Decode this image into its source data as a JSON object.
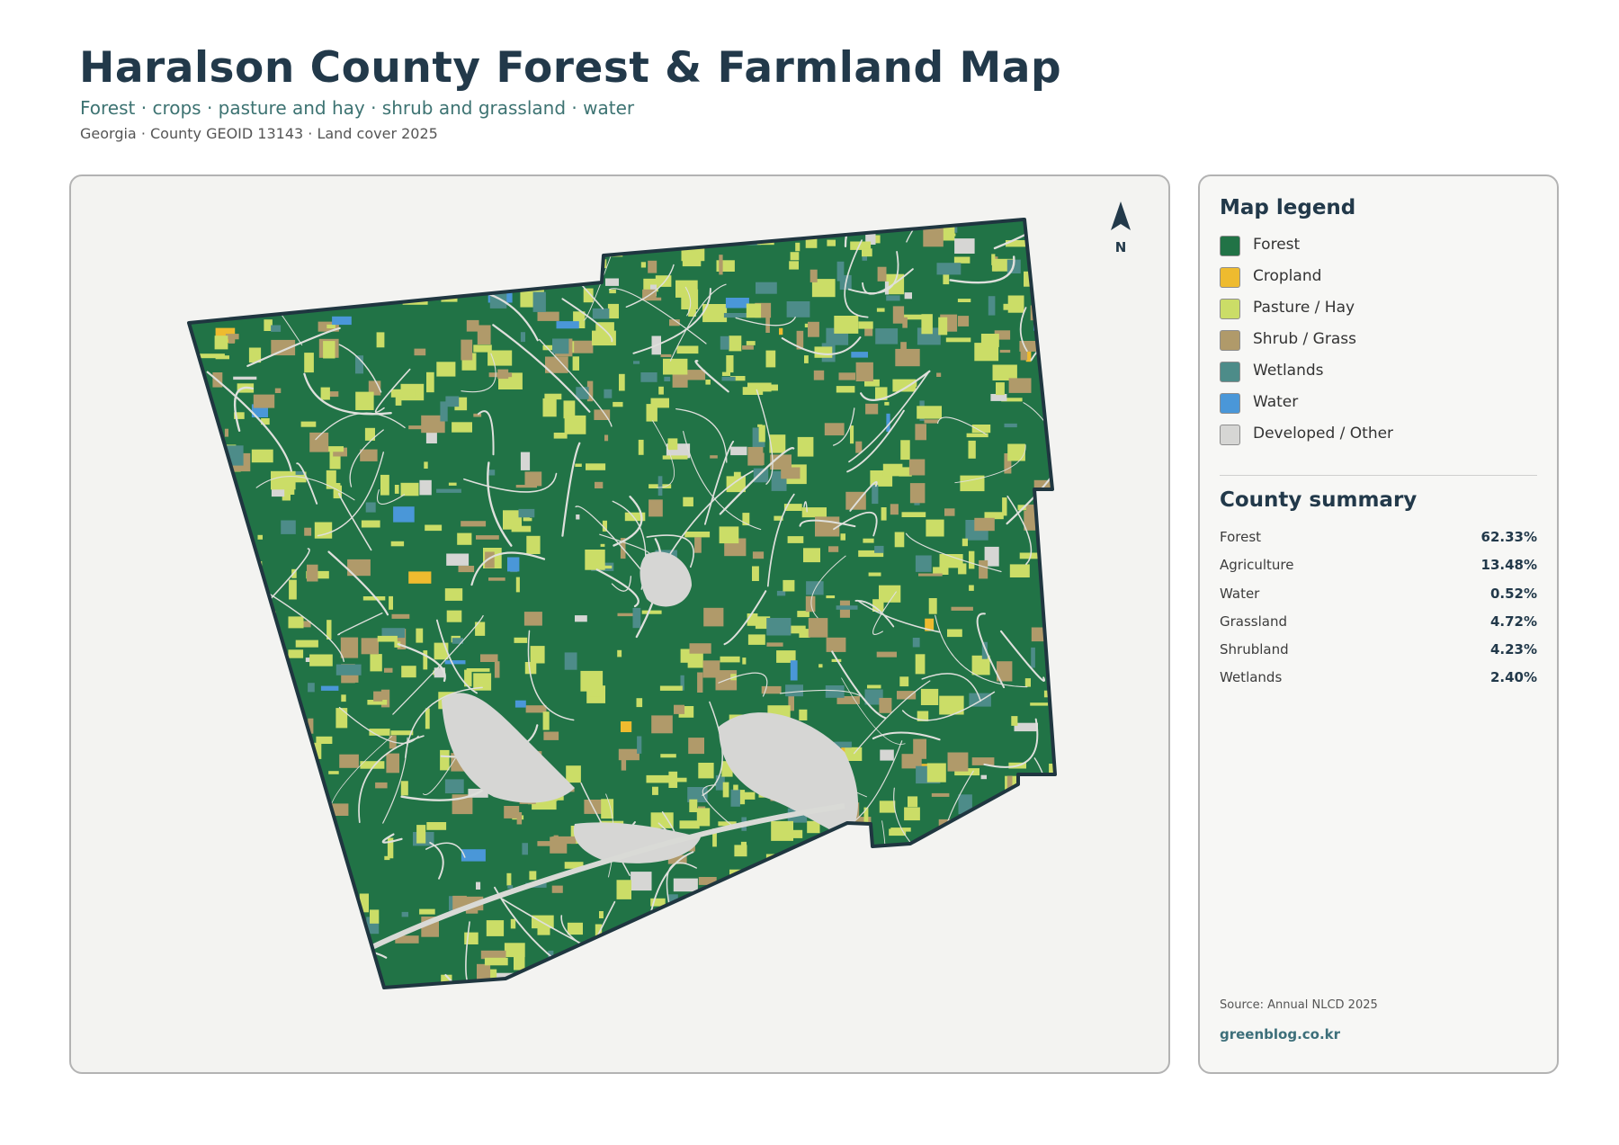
{
  "header": {
    "title": "Haralson County Forest & Farmland Map",
    "subtitle": "Forest · crops · pasture and hay · shrub and grassland · water",
    "meta": "Georgia · County GEOID 13143 · Land cover 2025"
  },
  "map": {
    "north_label": "N",
    "outline_color": "#1f3640"
  },
  "legend": {
    "heading": "Map legend",
    "items": [
      {
        "label": "Forest",
        "color": "#217346"
      },
      {
        "label": "Cropland",
        "color": "#eebb2f"
      },
      {
        "label": "Pasture / Hay",
        "color": "#cbdd67"
      },
      {
        "label": "Shrub / Grass",
        "color": "#b09a6a"
      },
      {
        "label": "Wetlands",
        "color": "#4d8c89"
      },
      {
        "label": "Water",
        "color": "#4a97d8"
      },
      {
        "label": "Developed / Other",
        "color": "#d6d6d4"
      }
    ]
  },
  "summary": {
    "heading": "County summary",
    "rows": [
      {
        "name": "Forest",
        "value": "62.33%"
      },
      {
        "name": "Agriculture",
        "value": "13.48%"
      },
      {
        "name": "Water",
        "value": "0.52%"
      },
      {
        "name": "Grassland",
        "value": "4.72%"
      },
      {
        "name": "Shrubland",
        "value": "4.23%"
      },
      {
        "name": "Wetlands",
        "value": "2.40%"
      }
    ]
  },
  "footer": {
    "source": "Source: Annual NLCD 2025",
    "credit": "greenblog.co.kr"
  }
}
